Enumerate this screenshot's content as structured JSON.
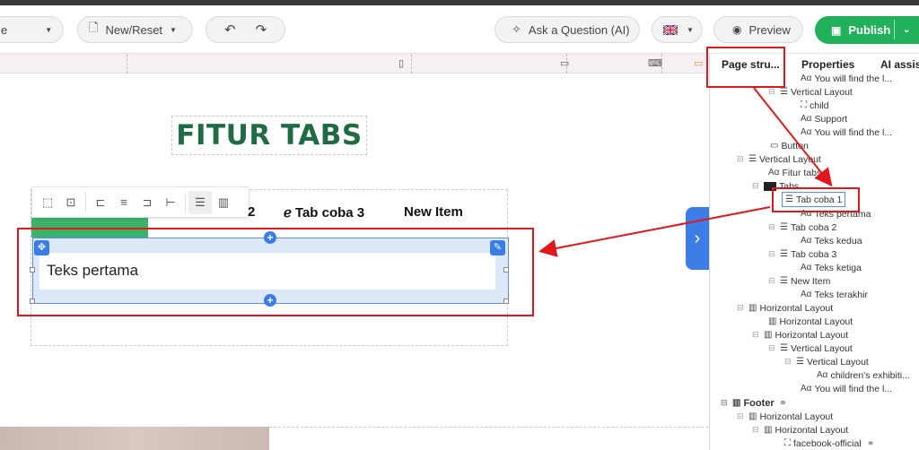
{
  "toolbar": {
    "page_select_label": "e",
    "new_reset_label": "New/Reset",
    "ask_ai_label": "Ask a Question (AI)",
    "preview_label": "Preview",
    "publish_label": "Publish"
  },
  "canvas": {
    "heading": "FITUR TABS",
    "tabs": [
      {
        "label": "2"
      },
      {
        "label": "Tab coba 3"
      },
      {
        "label": "New Item"
      }
    ],
    "active_panel_text": "Teks pertama"
  },
  "right_panel": {
    "tabs": [
      "Page stru...",
      "Properties",
      "AI assist"
    ],
    "tree": [
      {
        "label": "You will find the l...",
        "icon": "text-icon"
      },
      {
        "label": "Vertical Layout",
        "icon": "vertical-layout-icon"
      },
      {
        "label": "child",
        "icon": "image-icon"
      },
      {
        "label": "Support",
        "icon": "text-icon"
      },
      {
        "label": "You will find the l...",
        "icon": "text-icon"
      },
      {
        "label": "Button",
        "icon": "button-icon"
      },
      {
        "label": "Vertical Layout",
        "icon": "vertical-layout-icon"
      },
      {
        "label": "Fitur tabs",
        "icon": "text-icon"
      },
      {
        "label": "Tabs",
        "icon": "tabs-icon"
      },
      {
        "label": "Tab coba 1",
        "icon": "vertical-layout-icon"
      },
      {
        "label": "Teks pertama",
        "icon": "text-icon"
      },
      {
        "label": "Tab coba 2",
        "icon": "vertical-layout-icon"
      },
      {
        "label": "Teks kedua",
        "icon": "text-icon"
      },
      {
        "label": "Tab coba 3",
        "icon": "vertical-layout-icon"
      },
      {
        "label": "Teks ketiga",
        "icon": "text-icon"
      },
      {
        "label": "New Item",
        "icon": "vertical-layout-icon"
      },
      {
        "label": "Teks terakhir",
        "icon": "text-icon"
      },
      {
        "label": "Horizontal Layout",
        "icon": "horizontal-layout-icon"
      },
      {
        "label": "Horizontal Layout",
        "icon": "horizontal-layout-icon"
      },
      {
        "label": "Horizontal Layout",
        "icon": "horizontal-layout-icon"
      },
      {
        "label": "Vertical Layout",
        "icon": "vertical-layout-icon"
      },
      {
        "label": "Vertical Layout",
        "icon": "vertical-layout-icon"
      },
      {
        "label": "children's exhibiti...",
        "icon": "text-icon"
      },
      {
        "label": "You will find the l...",
        "icon": "text-icon"
      },
      {
        "label": "Footer",
        "icon": "horizontal-layout-icon"
      },
      {
        "label": "Horizontal Layout",
        "icon": "horizontal-layout-icon"
      },
      {
        "label": "Horizontal Layout",
        "icon": "horizontal-layout-icon"
      },
      {
        "label": "facebook-official",
        "icon": "image-icon"
      }
    ]
  },
  "colors": {
    "publish": "#21b15a",
    "heading": "#1f6b43",
    "tab_active": "#3cb36a",
    "selection": "#5b8ef0",
    "annotation": "#e0181b"
  }
}
